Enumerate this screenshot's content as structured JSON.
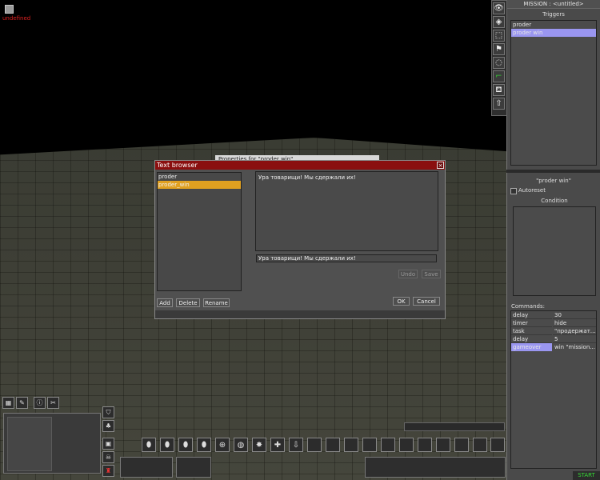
{
  "marker": {
    "label": "undefined"
  },
  "mission": {
    "title": "MISSION : <untitled>"
  },
  "triggers": {
    "group_label": "Triggers",
    "items": [
      {
        "label": "proder",
        "selected": false
      },
      {
        "label": "proder win",
        "selected": true
      }
    ]
  },
  "trigger_detail": {
    "name": "\"proder win\"",
    "autoreset_label": "Autoreset",
    "condition_label": "Condition",
    "commands_label": "Commands:",
    "commands": [
      {
        "cmd": "delay",
        "arg": "30"
      },
      {
        "cmd": "timer",
        "arg": "hide"
      },
      {
        "cmd": "task",
        "arg": "\"продержат…"
      },
      {
        "cmd": "delay",
        "arg": "5"
      },
      {
        "cmd": "gameover",
        "arg": "win \"mission..."
      }
    ]
  },
  "start_label": "START",
  "properties_window": {
    "title": "Properties for \"proder win\""
  },
  "text_browser": {
    "title": "Text browser",
    "close": "×",
    "items": [
      {
        "label": "proder"
      },
      {
        "label": "proder_win"
      }
    ],
    "text_value": "Ура товарищи! Мы сдержали их!",
    "field_value": "Ура товарищи! Мы сдержали их!",
    "undo": "Undo",
    "save": "Save",
    "add": "Add",
    "delete": "Delete",
    "rename": "Rename",
    "ok": "OK",
    "cancel": "Cancel"
  },
  "colors": {
    "title_bar": "#8a0f0f",
    "list_selected": "#e0a020",
    "trigger_selected": "#9a96f0",
    "start": "#36d836"
  },
  "tool_icons": [
    "eye-icon",
    "tag-icon",
    "select-area-icon",
    "flag-icon",
    "circle-icon",
    "step-icon",
    "camera-icon",
    "arrow-up-icon"
  ]
}
